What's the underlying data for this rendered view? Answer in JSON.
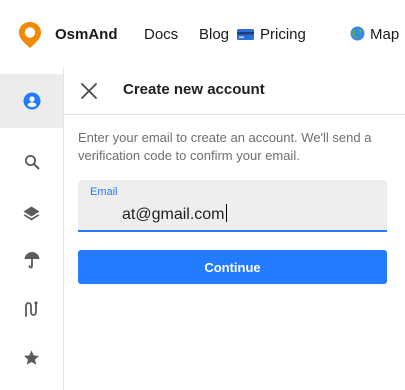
{
  "nav": {
    "brand": "OsmAnd",
    "links": [
      {
        "label": "Docs"
      },
      {
        "label": "Blog"
      },
      {
        "label": "Pricing",
        "icon": "credit-card-icon"
      },
      {
        "label": "Map",
        "icon": "globe-icon"
      }
    ]
  },
  "colors": {
    "brand_orange": "#f08a00",
    "accent_blue": "#237bff",
    "sidebar_icon": "#5b5b5b",
    "active_bg": "#ececec"
  },
  "sidebar": {
    "items": [
      {
        "icon": "account-icon",
        "active": true
      },
      {
        "icon": "search-icon"
      },
      {
        "icon": "layers-icon"
      },
      {
        "icon": "weather-icon"
      },
      {
        "icon": "route-icon"
      },
      {
        "icon": "favorites-star-icon"
      }
    ]
  },
  "panel": {
    "title": "Create new account",
    "description": "Enter your email to create an account. We'll send a verification code to confirm your email.",
    "email_label": "Email",
    "email_value": "at@gmail.com",
    "continue_label": "Continue"
  }
}
